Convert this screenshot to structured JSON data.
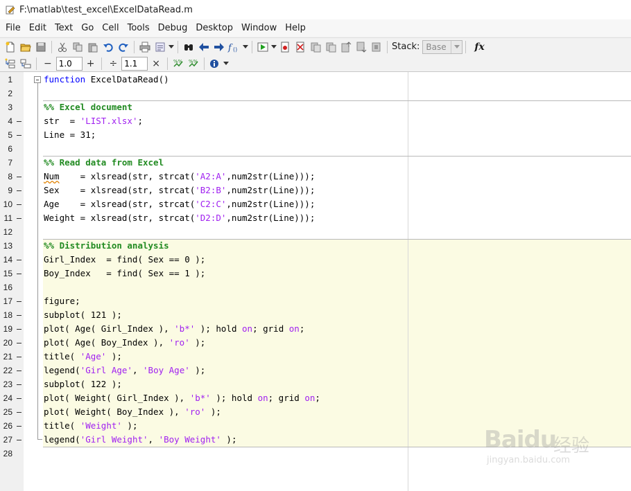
{
  "window": {
    "title": "F:\\matlab\\test_excel\\ExcelDataRead.m"
  },
  "menu": [
    "File",
    "Edit",
    "Text",
    "Go",
    "Cell",
    "Tools",
    "Debug",
    "Desktop",
    "Window",
    "Help"
  ],
  "toolbar": {
    "stack_label": "Stack:",
    "stack_value": "Base",
    "fx_label": "fx",
    "cell_decrement_value": "1.0",
    "cell_divide_value": "1.1"
  },
  "editor": {
    "lines": [
      {
        "n": "1",
        "fold": true,
        "dash": false,
        "html": "<span class=\"kw\">function</span> ExcelDataRead()"
      },
      {
        "n": "2",
        "dash": false,
        "html": ""
      },
      {
        "n": "3",
        "dash": false,
        "html": "<span class=\"cm\">%% Excel document</span>"
      },
      {
        "n": "4",
        "dash": true,
        "html": "str  = <span class=\"str\">'LIST.xlsx'</span>;"
      },
      {
        "n": "5",
        "dash": true,
        "html": "Line = 31;"
      },
      {
        "n": "6",
        "dash": false,
        "html": ""
      },
      {
        "n": "7",
        "dash": false,
        "html": "<span class=\"cm\">%% Read data from Excel</span>"
      },
      {
        "n": "8",
        "dash": true,
        "html": "<span class=\"warn\">Num</span>    = xlsread(str, strcat(<span class=\"str\">'A2:A'</span>,num2str(Line)));"
      },
      {
        "n": "9",
        "dash": true,
        "html": "Sex    = xlsread(str, strcat(<span class=\"str\">'B2:B'</span>,num2str(Line)));"
      },
      {
        "n": "10",
        "dash": true,
        "html": "Age    = xlsread(str, strcat(<span class=\"str\">'C2:C'</span>,num2str(Line)));"
      },
      {
        "n": "11",
        "dash": true,
        "html": "Weight = xlsread(str, strcat(<span class=\"str\">'D2:D'</span>,num2str(Line)));"
      },
      {
        "n": "12",
        "dash": false,
        "html": ""
      },
      {
        "n": "13",
        "dash": false,
        "html": "<span class=\"cm\">%% Distribution analysis</span>"
      },
      {
        "n": "14",
        "dash": true,
        "html": "Girl_Index  = find( Sex == 0 );"
      },
      {
        "n": "15",
        "dash": true,
        "html": "Boy_Index   = find( Sex == 1 );"
      },
      {
        "n": "16",
        "dash": false,
        "html": ""
      },
      {
        "n": "17",
        "dash": true,
        "html": "figure;"
      },
      {
        "n": "18",
        "dash": true,
        "html": "subplot( 121 );"
      },
      {
        "n": "19",
        "dash": true,
        "html": "plot( Age( Girl_Index ), <span class=\"str\">'b*'</span> ); hold <span class=\"str\">on</span>; grid <span class=\"str\">on</span>;"
      },
      {
        "n": "20",
        "dash": true,
        "html": "plot( Age( Boy_Index ), <span class=\"str\">'ro'</span> );"
      },
      {
        "n": "21",
        "dash": true,
        "html": "title( <span class=\"str\">'Age'</span> );"
      },
      {
        "n": "22",
        "dash": true,
        "html": "legend(<span class=\"str\">'Girl Age'</span>, <span class=\"str\">'Boy Age'</span> );"
      },
      {
        "n": "23",
        "dash": true,
        "html": "subplot( 122 );"
      },
      {
        "n": "24",
        "dash": true,
        "html": "plot( Weight( Girl_Index ), <span class=\"str\">'b*'</span> ); hold <span class=\"str\">on</span>; grid <span class=\"str\">on</span>;"
      },
      {
        "n": "25",
        "dash": true,
        "html": "plot( Weight( Boy_Index ), <span class=\"str\">'ro'</span> );"
      },
      {
        "n": "26",
        "dash": true,
        "html": "title( <span class=\"str\">'Weight'</span> );"
      },
      {
        "n": "27",
        "dash": true,
        "html": "legend(<span class=\"str\">'Girl Weight'</span>, <span class=\"str\">'Boy Weight'</span> );"
      },
      {
        "n": "28",
        "dash": false,
        "html": ""
      }
    ]
  },
  "watermark": {
    "main": "Baidu",
    "cn": "经验",
    "url": "jingyan.baidu.com"
  },
  "colors": {
    "keyword": "#0000ff",
    "string": "#a020f0",
    "comment": "#228b22",
    "cell_highlight": "#fbfbe3"
  }
}
